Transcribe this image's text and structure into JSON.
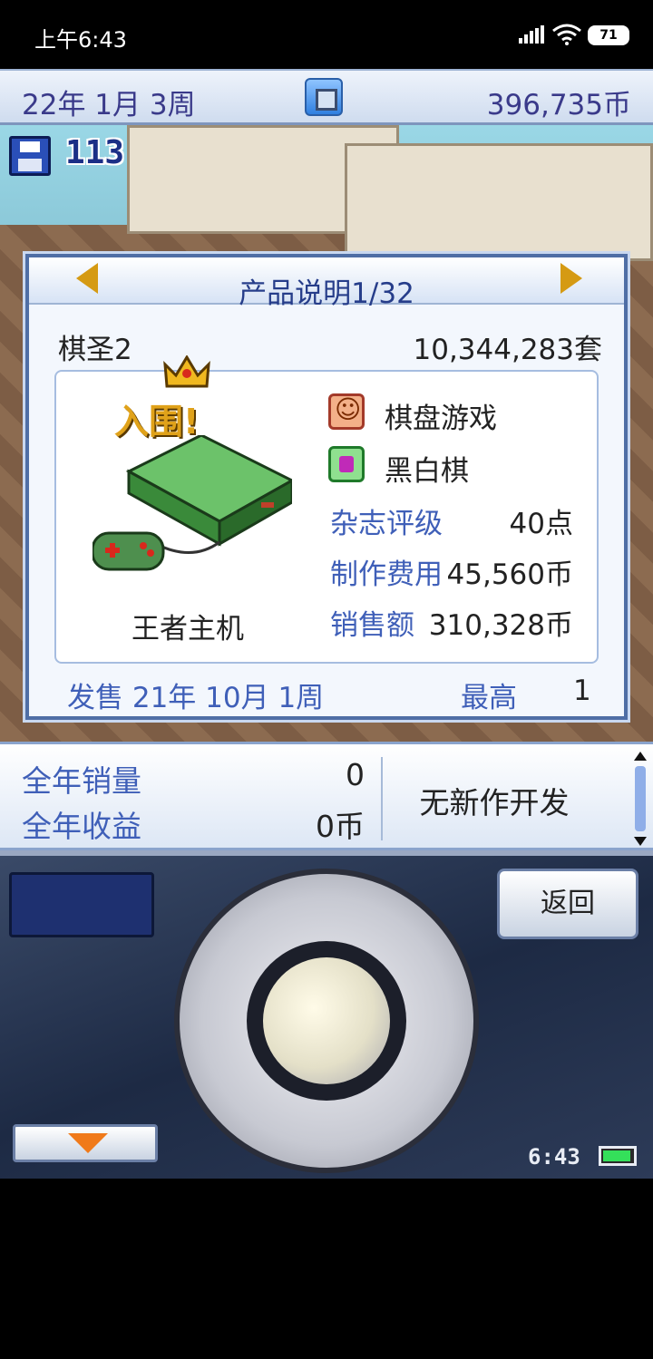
{
  "status_bar": {
    "time": "上午6:43",
    "battery": "71"
  },
  "top_bar": {
    "date": "22年 1月 3周",
    "money": "396,735币"
  },
  "scene": {
    "save_count": "113"
  },
  "product_dialog": {
    "title": "产品说明1/32",
    "product_name": "棋圣2",
    "units_sold": "10,344,283套",
    "award_badge": "入围!",
    "platform": "王者主机",
    "genre": "棋盘游戏",
    "theme": "黑白棋",
    "magazine_rating_label": "杂志评级",
    "magazine_rating_value": "40点",
    "production_cost_label": "制作费用",
    "production_cost_value": "45,560币",
    "sales_amount_label": "销售额",
    "sales_amount_value": "310,328币",
    "release_text": "发售 21年 10月 1周",
    "best_rank_label": "最高",
    "best_rank_value": "1"
  },
  "stats_bar": {
    "annual_sales_label": "全年销量",
    "annual_sales_value": "0",
    "annual_revenue_label": "全年收益",
    "annual_revenue_value": "0币",
    "development_status": "无新作开发"
  },
  "controller": {
    "back_label": "返回",
    "clock": "6:43"
  },
  "colors": {
    "accent_blue": "#3f5fb8",
    "title_blue": "#263d8a",
    "arrow_gold": "#d59a13",
    "down_arrow_orange": "#f07a1a"
  }
}
